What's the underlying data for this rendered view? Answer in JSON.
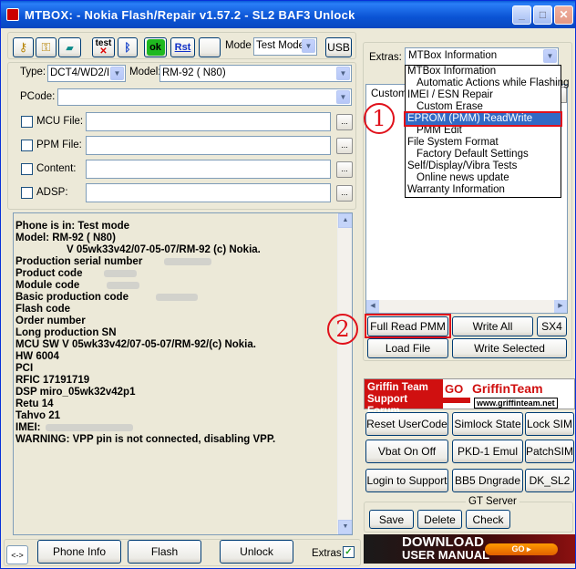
{
  "window": {
    "title": "MTBOX:          - Nokia Flash/Repair v1.57.2 - SL2 BAF3 Unlock",
    "minimize": "_",
    "maximize": "□",
    "close": "✕"
  },
  "toolbar": {
    "test_label": "test",
    "ok_label": "ok",
    "rst_label": "Rst",
    "mode_label": "Mode",
    "mode_value": "Test Mode",
    "usb_label": "USB"
  },
  "phone": {
    "type_label": "Type:",
    "type_value": "DCT4/WD2/I",
    "model_label": "Model:",
    "model_value": "RM-92 ( N80)",
    "pcode_label": "PCode:",
    "pcode_value": ""
  },
  "files": [
    {
      "label": "MCU File:",
      "browse": "..."
    },
    {
      "label": "PPM File:",
      "browse": "..."
    },
    {
      "label": "Content:",
      "browse": "..."
    },
    {
      "label": "ADSP:",
      "browse": "..."
    }
  ],
  "log": {
    "lines": [
      "Phone is in: Test mode",
      "Model: RM-92 ( N80)",
      "          V 05wk33v42/07-05-07/RM-92 (c) Nokia.",
      "Production serial number",
      "Product code",
      "Module code",
      "Basic production code",
      "Flash code",
      "Order number",
      "Long production SN",
      "MCU SW V 05wk33v42/07-05-07/RM-92/(c) Nokia.",
      "HW 6004",
      "PCI",
      "RFIC   17191719",
      "DSP   miro_05wk32v42p1",
      "Retu      14",
      "Tahvo    21",
      "               IMEI:",
      "WARNING: VPP pin is not connected, disabling VPP."
    ]
  },
  "extras": {
    "label": "Extras:",
    "selected": "MTBox Information",
    "custom_label": "Custom",
    "menu": [
      {
        "label": "MTBox Information",
        "sub": false
      },
      {
        "label": "Automatic Actions while Flashing",
        "sub": true
      },
      {
        "label": "IMEI / ESN Repair",
        "sub": false
      },
      {
        "label": "Custom Erase",
        "sub": true
      },
      {
        "label": "EPROM (PMM) ReadWrite",
        "sub": false,
        "selected": true
      },
      {
        "label": "PMM Edit",
        "sub": true
      },
      {
        "label": "File System Format",
        "sub": false
      },
      {
        "label": "Factory Default Settings",
        "sub": true
      },
      {
        "label": "Self/Display/Vibra Tests",
        "sub": false
      },
      {
        "label": "Online news update",
        "sub": true
      },
      {
        "label": "Warranty Information",
        "sub": false
      }
    ]
  },
  "actions": {
    "full_read_pmm": "Full Read PMM",
    "write_all": "Write All",
    "sx4": "SX4",
    "load_file": "Load File",
    "write_selected": "Write Selected"
  },
  "annotations": {
    "one": "1",
    "two": "2"
  },
  "banner_griffin": {
    "line1": "Griffin Team",
    "line2": "Support Forum",
    "go": "GO",
    "brand": "GriffinTeam",
    "url": "www.griffinteam.net"
  },
  "service": {
    "reset_usercode": "Reset UserCode",
    "simlock_state": "Simlock State",
    "lock_sim": "Lock SIM",
    "vbat_onoff": "Vbat On Off",
    "pkd1_emul": "PKD-1 Emul",
    "patchsim": "PatchSIM",
    "login_support": "Login to Support",
    "bb5_dngrade": "BB5 Dngrade",
    "dk_sl2": "DK_SL2"
  },
  "gt_server": {
    "title": "GT Server",
    "save": "Save",
    "delete": "Delete",
    "check": "Check"
  },
  "bottom": {
    "arrows": "<->",
    "phone_info": "Phone Info",
    "flash": "Flash",
    "unlock": "Unlock",
    "extras_label": "Extras",
    "extras_checked": "✓"
  },
  "banner_download": {
    "line1": "DOWNLOAD",
    "line2": "USER MANUAL",
    "go": "GO"
  }
}
